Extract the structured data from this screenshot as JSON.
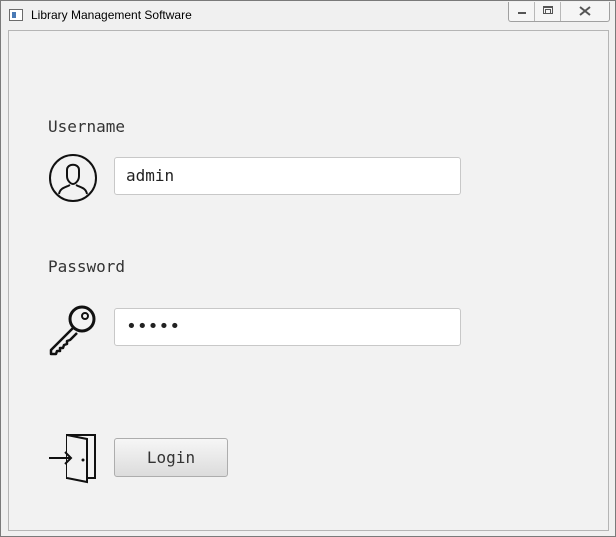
{
  "window": {
    "title": "Library Management Software"
  },
  "form": {
    "username_label": "Username",
    "username_value": "admin",
    "password_label": "Password",
    "password_value": "•••••",
    "login_label": "Login"
  },
  "icons": {
    "user": "user-circle-icon",
    "key": "key-icon",
    "login": "door-enter-icon"
  }
}
